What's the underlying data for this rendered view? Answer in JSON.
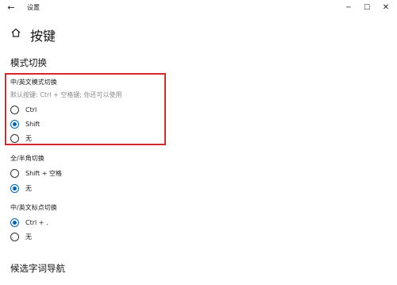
{
  "window": {
    "title": "设置",
    "controls": {
      "minimize": "─",
      "maximize": "☐",
      "close": "✕"
    }
  },
  "page": {
    "title": "按键"
  },
  "sections": {
    "mode_switch": {
      "heading": "模式切换"
    },
    "candidate_nav": {
      "heading": "候选字词导航"
    }
  },
  "groups": {
    "cn_en_switch": {
      "label": "中/英文模式切换",
      "description": "默认按键: Ctrl + 空格键; 你还可以使用",
      "options": [
        "Ctrl",
        "Shift",
        "无"
      ],
      "selected": "Shift"
    },
    "full_half_switch": {
      "label": "全/半角切换",
      "options": [
        "Shift + 空格",
        "无"
      ],
      "selected": "无"
    },
    "punct_switch": {
      "label": "中/英文标点切换",
      "options": [
        "Ctrl + .",
        "无"
      ],
      "selected": "Ctrl + ."
    }
  },
  "colors": {
    "accent": "#0063b1",
    "highlight_border": "#d4282c"
  },
  "icons": {
    "back": "back-arrow-icon",
    "home": "home-icon"
  }
}
